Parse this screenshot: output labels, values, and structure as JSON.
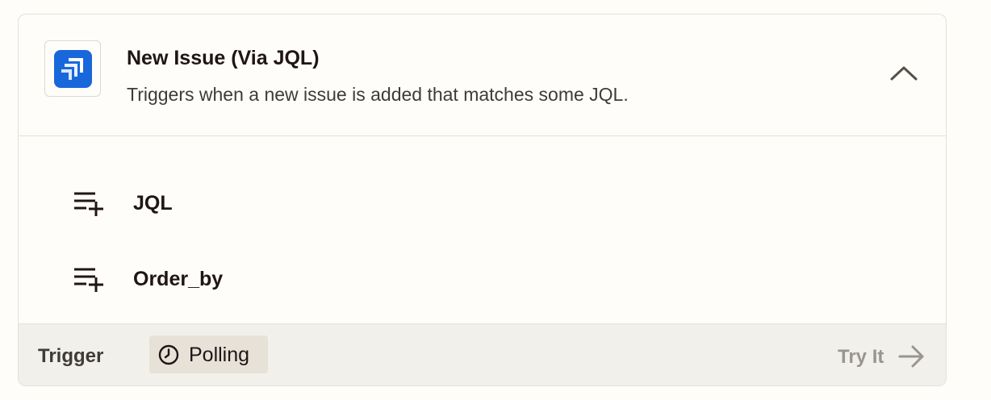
{
  "trigger_card": {
    "app_icon": "jira-logo-icon",
    "title": "New Issue (Via JQL)",
    "description": "Triggers when a new issue is added that matches some JQL.",
    "collapse_icon": "chevron-up-icon",
    "brand_color": "#1868db"
  },
  "fields": [
    {
      "icon": "playlist-add-icon",
      "label": "JQL"
    },
    {
      "icon": "playlist-add-icon",
      "label": "Order_by"
    }
  ],
  "footer": {
    "type_label": "Trigger",
    "badge": {
      "icon": "clock-icon",
      "label": "Polling"
    },
    "try_it": {
      "label": "Try It",
      "icon": "arrow-right-icon"
    }
  }
}
